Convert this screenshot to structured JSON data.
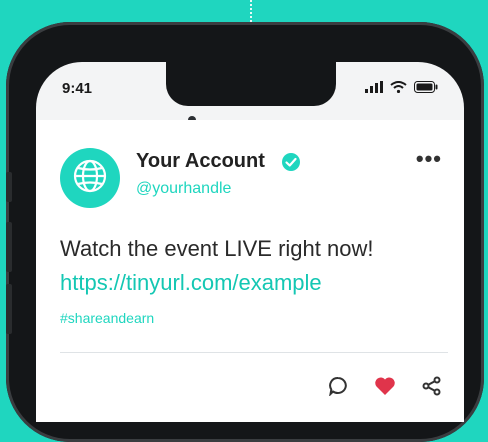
{
  "status_bar": {
    "time": "9:41",
    "icons": [
      "signal-icon",
      "wifi-icon",
      "battery-icon"
    ]
  },
  "post": {
    "account_name": "Your Account",
    "verified": true,
    "handle": "@yourhandle",
    "text": "Watch the event LIVE right now!",
    "link": "https://tinyurl.com/example",
    "hashtag": "#shareandearn",
    "actions": [
      "comment-icon",
      "like-icon",
      "share-icon"
    ]
  },
  "colors": {
    "brand": "#1fd6bf",
    "like": "#e0344b",
    "frame": "#141618"
  }
}
